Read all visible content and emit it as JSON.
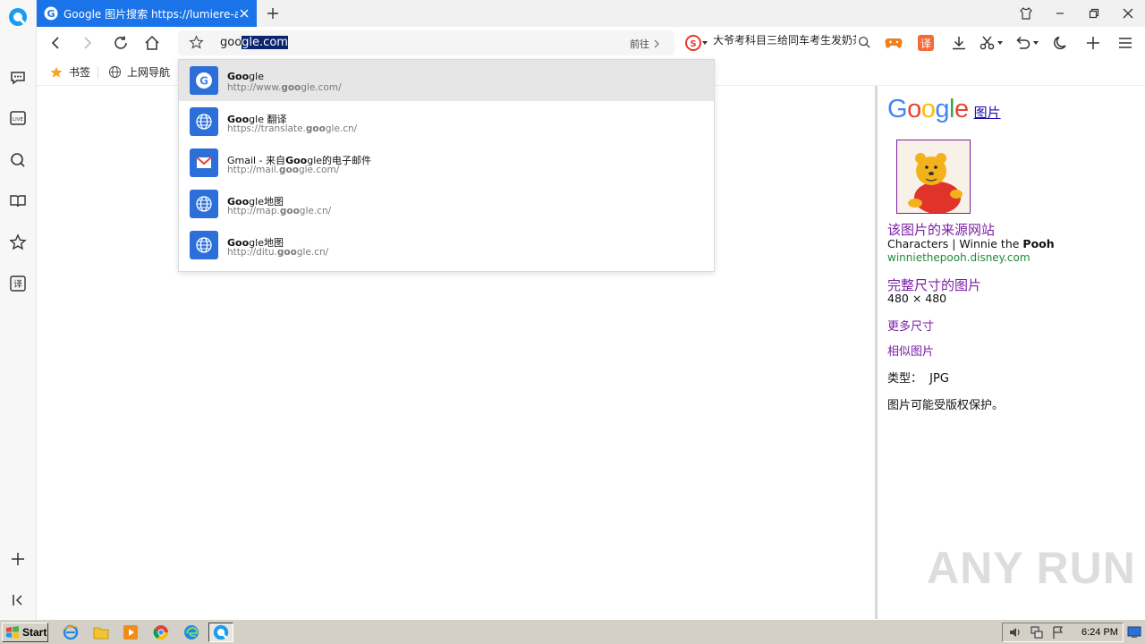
{
  "tab": {
    "title": "Google 图片搜索 https://lumiere-a.akamaihd.net",
    "close_label": "×",
    "new_tab_label": "+"
  },
  "address_bar": {
    "typed_prefix": "goo",
    "selected_suffix": "gle.com",
    "go_label": "前往"
  },
  "search_box": {
    "query": "大爷考科目三给同车考生发奶茶"
  },
  "bookmarks": [
    {
      "label": "书签",
      "icon": "star-icon"
    },
    {
      "label": "上网导航",
      "icon": "globe-icon"
    }
  ],
  "suggestions": [
    {
      "title_bold": "Goo",
      "title_rest": "gle",
      "url_pre": "http://www.",
      "url_bold": "goo",
      "url_post": "gle.com/",
      "icon": "google-icon"
    },
    {
      "title_bold": "Goo",
      "title_rest": "gle 翻译",
      "url_pre": "https://translate.",
      "url_bold": "goo",
      "url_post": "gle.cn/",
      "icon": "globe-icon"
    },
    {
      "title_pre": "Gmail - 来自",
      "title_bold": "Goo",
      "title_rest": "gle的电子邮件",
      "url_pre": "http://mail.",
      "url_bold": "goo",
      "url_post": "gle.com/",
      "icon": "gmail-icon"
    },
    {
      "title_bold": "Goo",
      "title_rest": "gle地图",
      "url_pre": "http://map.",
      "url_bold": "goo",
      "url_post": "gle.cn/",
      "icon": "globe-icon"
    },
    {
      "title_bold": "Goo",
      "title_rest": "gle地图",
      "url_pre": "http://ditu.",
      "url_bold": "goo",
      "url_post": "gle.cn/",
      "icon": "globe-icon"
    }
  ],
  "image_panel": {
    "logo": "Google",
    "logo_suffix": "图片",
    "source_heading": "该图片的来源网站",
    "source_title_pre": "Characters | Winnie the ",
    "source_title_bold": "Pooh",
    "source_domain": "winniethepooh.disney.com",
    "full_size_label": "完整尺寸的图片",
    "dimensions": "480 × 480",
    "more_sizes": "更多尺寸",
    "similar_images": "相似图片",
    "type_label": "类型：",
    "type_value": "JPG",
    "copyright_note": "图片可能受版权保护。"
  },
  "taskbar": {
    "start_label": "Start",
    "clock": "6:24 PM"
  },
  "watermark": "ANY RUN",
  "colors": {
    "tab_blue": "#1a73e8",
    "link_purple": "#7b1fa2",
    "url_green": "#1e8a3a"
  }
}
